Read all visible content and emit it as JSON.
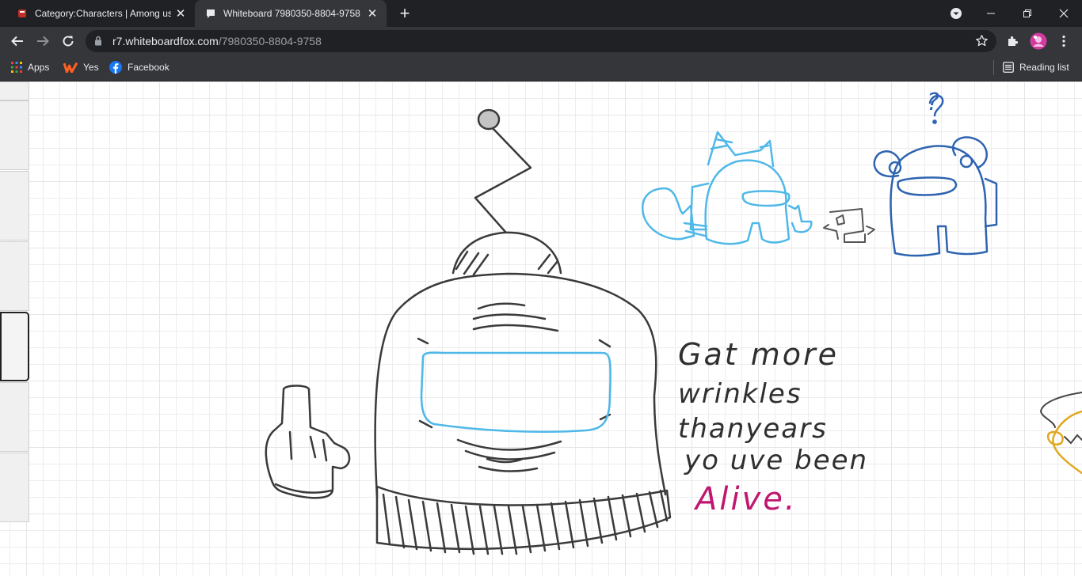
{
  "tabs": [
    {
      "title": "Category:Characters | Among us",
      "active": false
    },
    {
      "title": "Whiteboard 7980350-8804-9758",
      "active": true
    }
  ],
  "omnibox": {
    "host": "r7.whiteboardfox.com",
    "path": "/7980350-8804-9758"
  },
  "bookmarks": [
    {
      "label": "Apps",
      "icon": "apps-grid-icon"
    },
    {
      "label": "Yes",
      "icon": "wattpad-icon"
    },
    {
      "label": "Facebook",
      "icon": "facebook-icon"
    }
  ],
  "reading_list": {
    "label": "Reading list"
  },
  "canvas": {
    "question_mark": "?",
    "note_lines": [
      "Gat more",
      "wrinkles",
      "thanyears",
      "yo uve been"
    ],
    "note_alive": "Alive."
  },
  "colors": {
    "tabbar": "#202124",
    "toolbar": "#35363a",
    "ink_black": "#3a3a3a",
    "ink_light_blue": "#4fb8e8",
    "ink_dark_blue": "#2d63b0",
    "ink_magenta": "#c0166f",
    "ink_yellow": "#e0a820"
  }
}
